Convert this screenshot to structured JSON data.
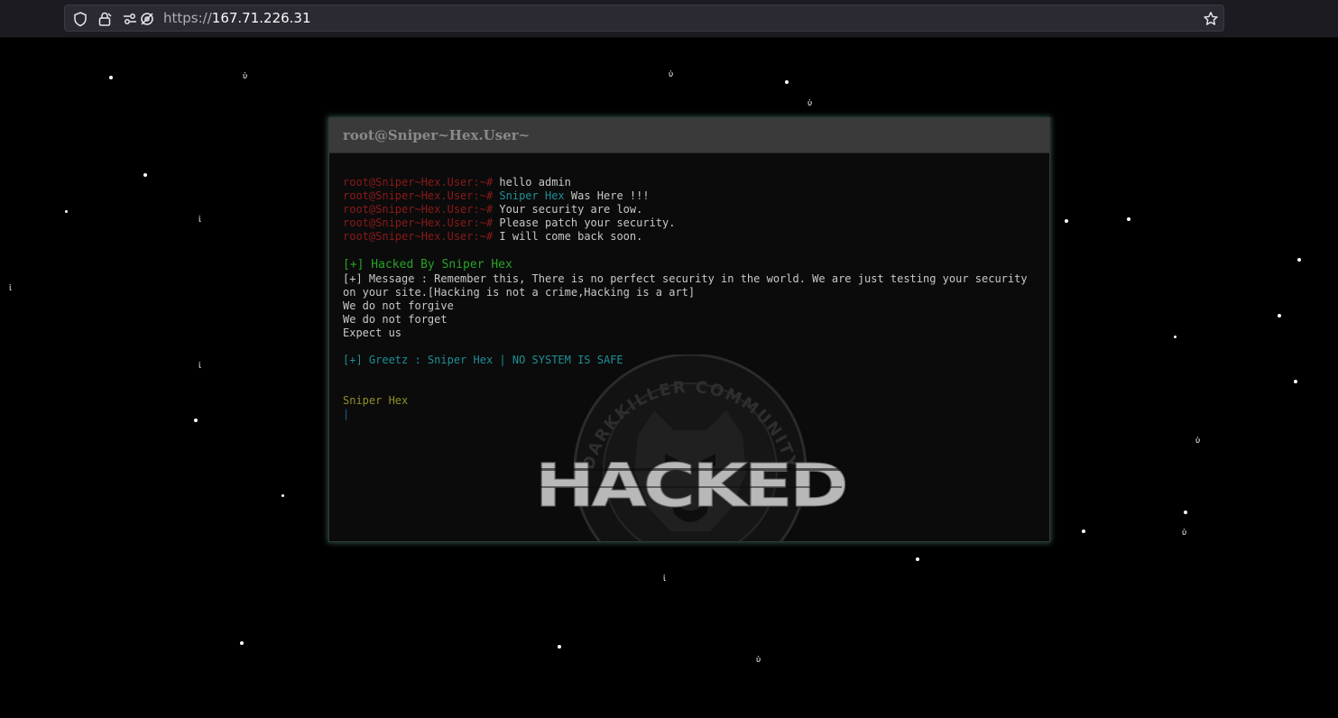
{
  "browser": {
    "url_scheme": "https://",
    "url_host": "167.71.226.31",
    "icons": [
      "shield-icon",
      "lock-icon",
      "permissions-icon",
      "tracking-blocked-icon",
      "bookmark-star-icon"
    ]
  },
  "terminal": {
    "title": "root@Sniper~Hex.User~",
    "prompt": "root@Sniper~Hex.User:~#",
    "commands": [
      {
        "text": "hello admin"
      },
      {
        "highlight": "Sniper Hex",
        "text": " Was Here !!!"
      },
      {
        "text": "Your security are low."
      },
      {
        "text": "Please patch your security."
      },
      {
        "text": "I will come back soon."
      }
    ],
    "hacked_by": "[+] Hacked By Sniper Hex",
    "message": "[+] Message : Remember this, There is no perfect security in the world. We are just testing your security on your site.[Hacking is not a crime,Hacking is a art]",
    "motto": [
      "We do not forgive",
      "We do not forget",
      "Expect us"
    ],
    "greetz": "[+] Greetz : Sniper Hex | NO SYSTEM IS SAFE",
    "signature": "Sniper Hex",
    "cursor": "|"
  },
  "emblem": {
    "ring_text": "DARKKILLER COMMUNITY",
    "word": "HACKED"
  },
  "colors": {
    "background": "#000000",
    "prompt": "#8b1a1a",
    "teal": "#1f8f95",
    "green": "#27a327",
    "signature": "#8f8f2a"
  }
}
